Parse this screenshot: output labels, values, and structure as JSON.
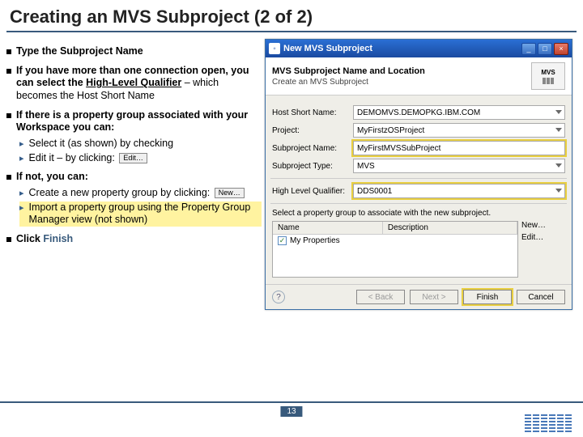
{
  "slide": {
    "title": "Creating an MVS Subproject (2 of 2)",
    "page_number": "13"
  },
  "left": {
    "b1": "Type the Subproject Name",
    "b2_a": "If you have more than one connection open, you can select the ",
    "b2_bold": "High-Level Qualifier",
    "b2_b": " – which becomes the Host Short Name",
    "b3": "If there is a property group associated with your Workspace you can:",
    "b3_s1": "Select it (as shown) by checking",
    "b3_s2": "Edit it – by clicking:",
    "b4": "If not, you can:",
    "b4_s1": "Create a new property group by clicking:",
    "b4_s2": "Import a property group using the Property Group Manager view (not shown)",
    "b5_a": "Click ",
    "b5_bold": "Finish",
    "inline_edit": "Edit…",
    "inline_new": "New…"
  },
  "dialog": {
    "title": "New MVS Subproject",
    "header_title": "MVS Subproject Name and Location",
    "header_sub": "Create an MVS Subproject",
    "badge": "MVS",
    "labels": {
      "host": "Host Short Name:",
      "project": "Project:",
      "subname": "Subproject Name:",
      "subtype": "Subproject Type:",
      "hlq": "High Level Qualifier:"
    },
    "values": {
      "host": "DEMOMVS.DEMOPKG.IBM.COM",
      "project": "MyFirstzOSProject",
      "subname": "MyFirstMVSSubProject",
      "subtype": "MVS",
      "hlq": "DDS0001"
    },
    "pg_label": "Select a property group to associate with the new subproject.",
    "table": {
      "col1": "Name",
      "col2": "Description",
      "row1": "My Properties"
    },
    "buttons": {
      "new": "New…",
      "edit": "Edit…",
      "back": "< Back",
      "next": "Next >",
      "finish": "Finish",
      "cancel": "Cancel"
    }
  }
}
